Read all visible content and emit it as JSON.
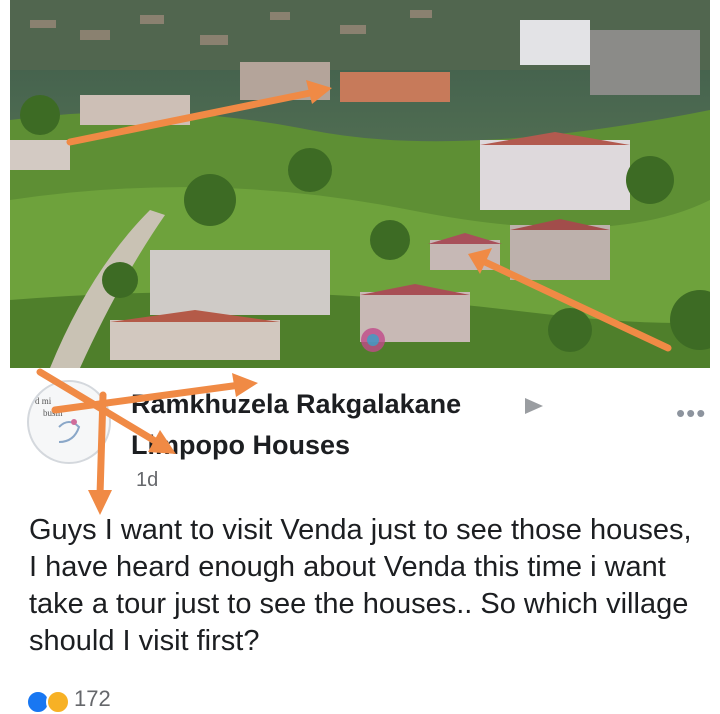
{
  "photo": {
    "description_icon": "houses-photo"
  },
  "post": {
    "author": "Ramkhuzela Rakgalakane",
    "group": "Limpopo Houses",
    "time": "1d",
    "more_icon": "more-horizontal-icon",
    "text": "Guys I want to visit Venda just to see those houses, I have heard enough about Venda this time i want take a tour just to see the houses.. So which village should I visit first?",
    "reaction_count": "172",
    "avatar_caption_1": "d mi",
    "avatar_caption_2": "busin"
  },
  "colors": {
    "arrow": "#f08a45",
    "text": "#1c1e21",
    "muted": "#65676b"
  }
}
